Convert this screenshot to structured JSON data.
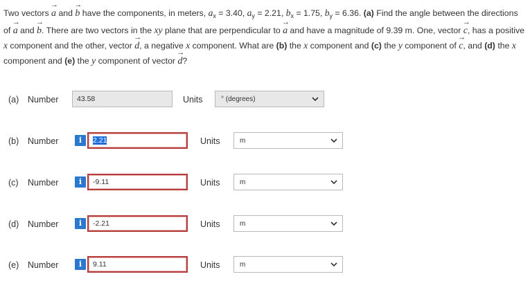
{
  "question": {
    "t1": "Two vectors ",
    "a": "a",
    "t2": " and ",
    "b": "b",
    "t3": " have the components, in meters, ",
    "t4": " = 3.40, ",
    "t5": " = 2.21, ",
    "t6": " = 1.75, ",
    "t7": " = 6.36. ",
    "pa": "(a)",
    "t8": " Find the angle between the directions of ",
    "t9": " and ",
    "t10": ". There are two vectors in the ",
    "xy": "xy",
    "t11": " plane that are perpendicular to ",
    "t12": " and have a magnitude of 9.39 m. One, vector ",
    "c": "c",
    "t13": ", has a positive ",
    "x1": "x",
    "t14": " component and the other, vector ",
    "d": "d",
    "t15": ", a negative ",
    "x2": "x",
    "t16": " component. What are ",
    "pb": "(b)",
    "t17": " the ",
    "x3": "x",
    "t18": " component and ",
    "pc": "(c)",
    "t19": " the ",
    "y1": "y",
    "t20": " component of ",
    "t21": ", and ",
    "pd": "(d)",
    "t22": " the ",
    "x4": "x",
    "t23": " component and ",
    "pe": "(e)",
    "t24": " the ",
    "y2": "y",
    "t25": " component of vector ",
    "t26": "?",
    "ax_b": "a",
    "ax_s": "x",
    "ay_b": "a",
    "ay_s": "y",
    "bx_b": "b",
    "bx_s": "x",
    "by_b": "b",
    "by_s": "y",
    "arrow": "→"
  },
  "answers": [
    {
      "part": "(a)",
      "label": "Number",
      "value": "43.58",
      "units_label": "Units",
      "unit": "° (degrees)"
    },
    {
      "part": "(b)",
      "label": "Number",
      "value": "2.21",
      "units_label": "Units",
      "unit": "m"
    },
    {
      "part": "(c)",
      "label": "Number",
      "value": "-9.11",
      "units_label": "Units",
      "unit": "m"
    },
    {
      "part": "(d)",
      "label": "Number",
      "value": "-2.21",
      "units_label": "Units",
      "unit": "m"
    },
    {
      "part": "(e)",
      "label": "Number",
      "value": "9.11",
      "units_label": "Units",
      "unit": "m"
    }
  ],
  "icons": {
    "info": "i",
    "info_icon": "info-icon",
    "dropdown_icon": "chevron-down-icon"
  },
  "colors": {
    "info_bg": "#2b78d0",
    "error_border": "#b63b3b",
    "graded_bg": "#e8e8e8"
  }
}
